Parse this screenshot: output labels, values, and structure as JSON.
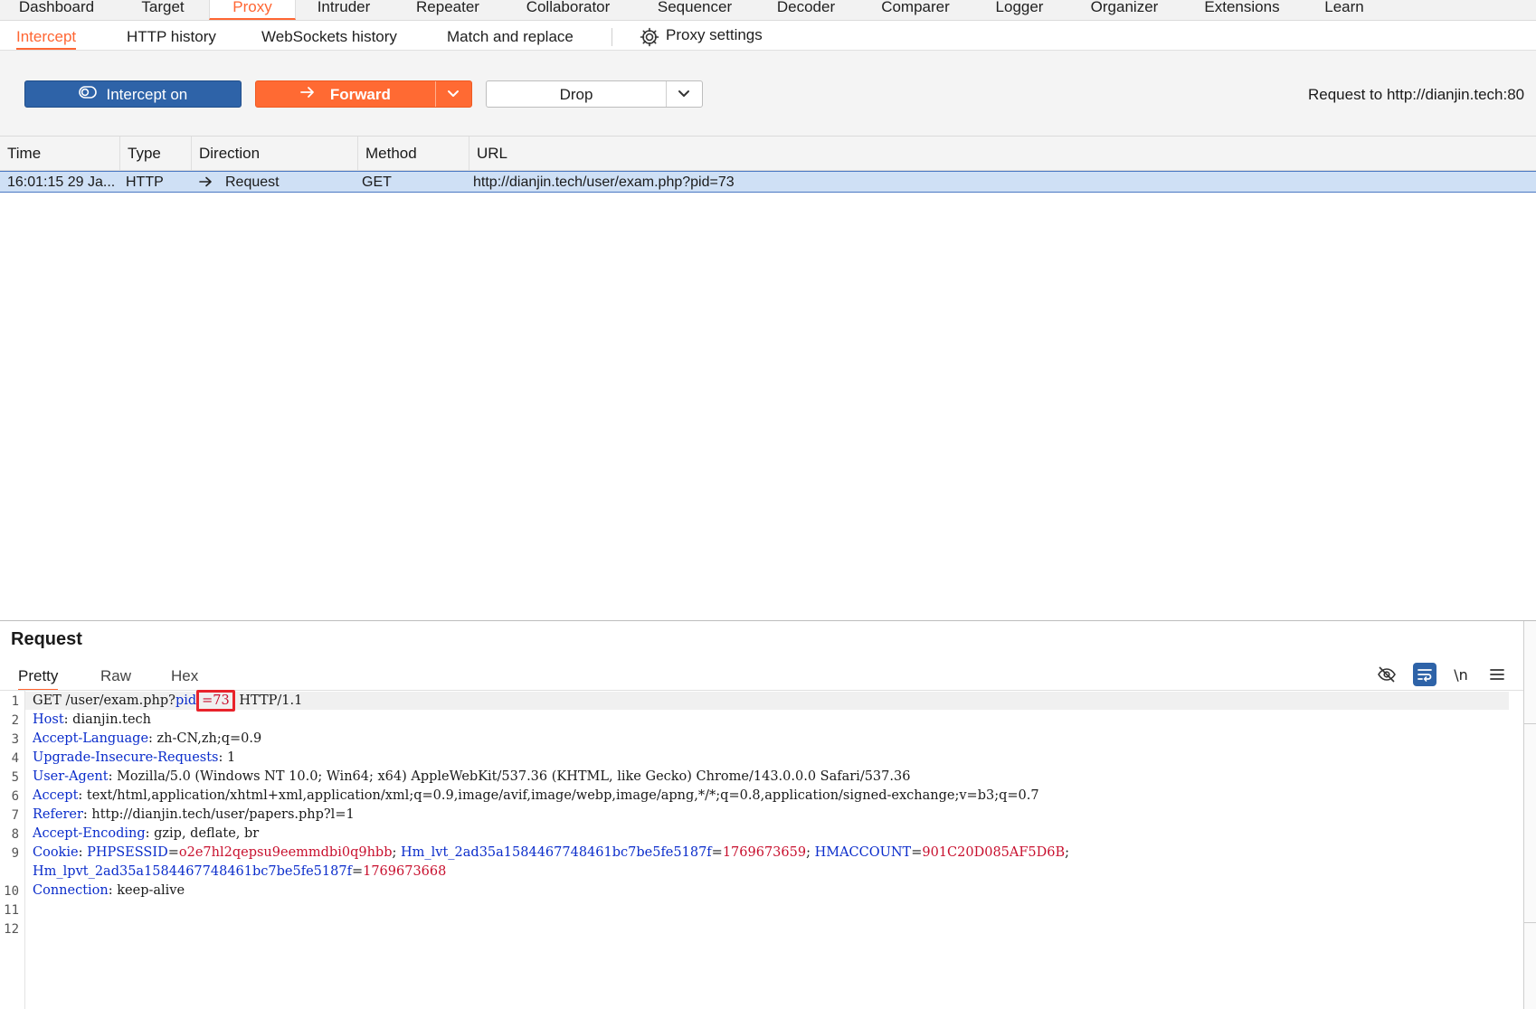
{
  "nav": {
    "tabs": [
      {
        "label": "Dashboard"
      },
      {
        "label": "Target"
      },
      {
        "label": "Proxy"
      },
      {
        "label": "Intruder"
      },
      {
        "label": "Repeater"
      },
      {
        "label": "Collaborator"
      },
      {
        "label": "Sequencer"
      },
      {
        "label": "Decoder"
      },
      {
        "label": "Comparer"
      },
      {
        "label": "Logger"
      },
      {
        "label": "Organizer"
      },
      {
        "label": "Extensions"
      },
      {
        "label": "Learn"
      }
    ],
    "active": "Proxy"
  },
  "subnav": {
    "tabs": [
      {
        "label": "Intercept"
      },
      {
        "label": "HTTP history"
      },
      {
        "label": "WebSockets history"
      },
      {
        "label": "Match and replace"
      }
    ],
    "settings_label": "Proxy settings"
  },
  "toolbar": {
    "intercept_label": "Intercept on",
    "forward_label": "Forward",
    "drop_label": "Drop",
    "request_to": "Request to http://dianjin.tech:80"
  },
  "table": {
    "headers": [
      "Time",
      "Type",
      "Direction",
      "Method",
      "URL"
    ],
    "rows": [
      {
        "time": "16:01:15 29 Ja...",
        "type": "HTTP",
        "direction": "Request",
        "method": "GET",
        "url": "http://dianjin.tech/user/exam.php?pid=73"
      }
    ]
  },
  "request": {
    "title": "Request",
    "tabs": [
      "Pretty",
      "Raw",
      "Hex"
    ],
    "newline_label": "\\n",
    "lines": {
      "l1": {
        "method": "GET /user/exam.php?",
        "param": "pid",
        "value": "=73",
        "rest": " HTTP/1.1"
      },
      "l2": {
        "key": "Host",
        "val": " dianjin.tech"
      },
      "l3": {
        "key": "Accept-Language",
        "val": " zh-CN,zh;q=0.9"
      },
      "l4": {
        "key": "Upgrade-Insecure-Requests",
        "val": " 1"
      },
      "l5": {
        "key": "User-Agent",
        "val": " Mozilla/5.0 (Windows NT 10.0; Win64; x64) AppleWebKit/537.36 (KHTML, like Gecko) Chrome/143.0.0.0 Safari/537.36"
      },
      "l6": {
        "key": "Accept",
        "val": " text/html,application/xhtml+xml,application/xml;q=0.9,image/avif,image/webp,image/apng,*/*;q=0.8,application/signed-exchange;v=b3;q=0.7"
      },
      "l7": {
        "key": "Referer",
        "val": " http://dianjin.tech/user/papers.php?l=1"
      },
      "l8": {
        "key": "Accept-Encoding",
        "val": " gzip, deflate, br"
      },
      "l9": {
        "key": "Cookie",
        "c1k": "PHPSESSID",
        "c1v": "o2e7hl2qepsu9eemmdbi0q9hbb",
        "c2k": "Hm_lvt_2ad35a1584467748461bc7be5fe5187f",
        "c2v": "1769673659",
        "c3k": "HMACCOUNT",
        "c3v": "901C20D085AF5D6B",
        "c4k": "Hm_lpvt_2ad35a1584467748461bc7be5fe5187f",
        "c4v": "1769673668"
      },
      "l10": {
        "key": "Connection",
        "val": " keep-alive"
      }
    },
    "line_numbers": [
      "1",
      "2",
      "3",
      "4",
      "5",
      "6",
      "7",
      "8",
      "9",
      "10",
      "11",
      "12"
    ]
  }
}
